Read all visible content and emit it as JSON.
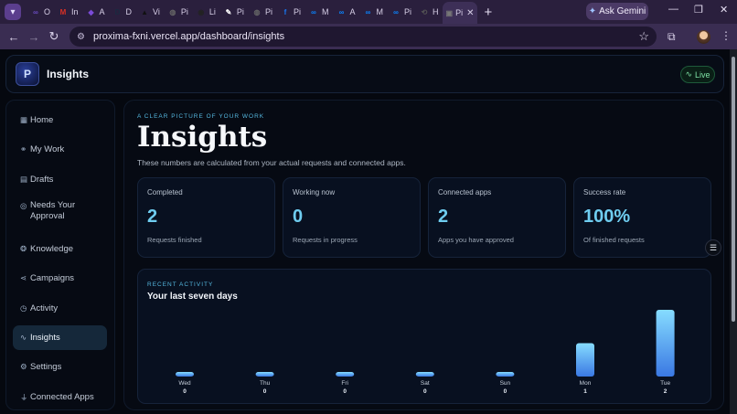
{
  "browser": {
    "tabs": [
      {
        "label": "O",
        "icon": "mozilla-icon",
        "color": "#6a4cc2"
      },
      {
        "label": "In",
        "icon": "gmail-icon",
        "color": "#d93025"
      },
      {
        "label": "A",
        "icon": "app-icon",
        "color": "#7b4bd8"
      },
      {
        "label": "D",
        "icon": "d-icon",
        "color": "#1a2a40"
      },
      {
        "label": "Vi",
        "icon": "vercel-icon",
        "color": "#111111"
      },
      {
        "label": "Pi",
        "icon": "globe-icon",
        "color": "#666666"
      },
      {
        "label": "Li",
        "icon": "github-icon",
        "color": "#222222"
      },
      {
        "label": "Pi",
        "icon": "puzzle-icon",
        "color": "#ffffff"
      },
      {
        "label": "Pi",
        "icon": "globe-icon",
        "color": "#666666"
      },
      {
        "label": "Pi",
        "icon": "facebook-icon",
        "color": "#1877f2"
      },
      {
        "label": "M",
        "icon": "meta-icon",
        "color": "#0a84ff"
      },
      {
        "label": "A",
        "icon": "meta-icon",
        "color": "#0a84ff"
      },
      {
        "label": "M",
        "icon": "meta-icon",
        "color": "#0a84ff"
      },
      {
        "label": "Pi",
        "icon": "meta-icon",
        "color": "#0a84ff"
      },
      {
        "label": "H",
        "icon": "history-icon",
        "color": "#555555"
      },
      {
        "label": "Pi",
        "icon": "page-icon",
        "color": "#777777",
        "active": true
      }
    ],
    "gemini_label": "Ask Gemini",
    "url": "proxima-fxni.vercel.app/dashboard/insights"
  },
  "app": {
    "title": "Insights",
    "live_label": "Live"
  },
  "sidebar": {
    "items": [
      {
        "label": "Home",
        "icon": "grid-icon"
      },
      {
        "label": "My Work",
        "icon": "workflow-icon"
      },
      {
        "label": "Drafts",
        "icon": "document-icon"
      },
      {
        "label": "Needs Your Approval",
        "icon": "check-circle-icon"
      },
      {
        "label": "Knowledge",
        "icon": "brain-icon"
      },
      {
        "label": "Campaigns",
        "icon": "share-icon"
      },
      {
        "label": "Activity",
        "icon": "clock-icon"
      },
      {
        "label": "Insights",
        "icon": "pulse-icon",
        "active": true
      },
      {
        "label": "Settings",
        "icon": "gear-icon"
      },
      {
        "label": "Connected Apps",
        "icon": "plug-icon"
      }
    ]
  },
  "main": {
    "eyebrow": "A CLEAR PICTURE OF YOUR WORK",
    "heading": "Insights",
    "subtitle": "These numbers are calculated from your actual requests and connected apps.",
    "stats": [
      {
        "label": "Completed",
        "value": "2",
        "desc": "Requests finished"
      },
      {
        "label": "Working now",
        "value": "0",
        "desc": "Requests in progress"
      },
      {
        "label": "Connected apps",
        "value": "2",
        "desc": "Apps you have approved"
      },
      {
        "label": "Success rate",
        "value": "100%",
        "desc": "Of finished requests"
      }
    ],
    "activity": {
      "eyebrow": "RECENT ACTIVITY",
      "title": "Your last seven days"
    }
  },
  "chart_data": {
    "type": "bar",
    "categories": [
      "Wed",
      "Thu",
      "Fri",
      "Sat",
      "Sun",
      "Mon",
      "Tue"
    ],
    "values": [
      0,
      0,
      0,
      0,
      0,
      1,
      2
    ],
    "ylim": [
      0,
      2
    ],
    "grid": false
  }
}
